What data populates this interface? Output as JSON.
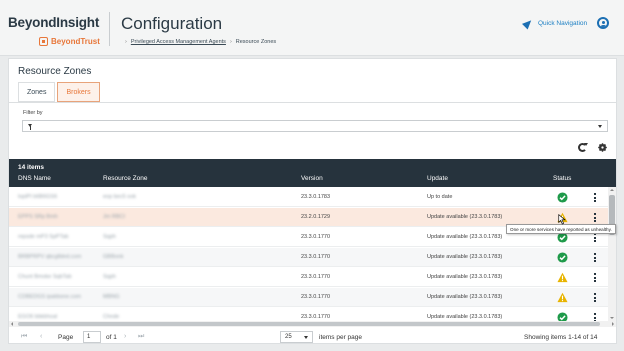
{
  "header": {
    "brand_name": "BeyondInsight",
    "brand_sub": "BeyondTrust",
    "page_title": "Configuration",
    "breadcrumb": [
      "Privileged Access Management Agents",
      "Resource Zones"
    ],
    "quick_nav_label": "Quick Navigation"
  },
  "card": {
    "title": "Resource Zones",
    "tabs": [
      {
        "label": "Zones",
        "active": false
      },
      {
        "label": "Brokers",
        "active": true
      }
    ],
    "filter_label": "Filter by"
  },
  "table": {
    "items_count": "14 items",
    "columns": [
      "DNS Name",
      "Resource Zone",
      "Version",
      "Update",
      "Status"
    ],
    "rows": [
      {
        "dns": "lopiPI b6B6GS6",
        "zone": "eop bec5 ook",
        "version": "23.3.0.1783",
        "update": "Up to date",
        "status": "ok",
        "style": "normal"
      },
      {
        "dns": "EPPS SRp Bmh",
        "zone": "Jm RBCI",
        "version": "23.2.0.1729",
        "update": "Update available (23.3.0.1783)",
        "status": "warn",
        "style": "selected"
      },
      {
        "dns": "repsde mP3 SpPTab",
        "zone": "Sqph",
        "version": "23.3.0.1770",
        "update": "Update available (23.3.0.1783)",
        "status": "ok",
        "style": "normal"
      },
      {
        "dns": "BRBPRPV qbcglbled.com",
        "zone": "GBBonk",
        "version": "23.3.0.1770",
        "update": "Update available (23.3.0.1783)",
        "status": "ok",
        "style": "alt"
      },
      {
        "dns": "Chunt Bmoke SqbTab",
        "zone": "Sqph",
        "version": "23.3.0.1770",
        "update": "Update available (23.3.0.1783)",
        "status": "warn",
        "style": "normal"
      },
      {
        "dns": "CDBEDGS ipakbone.com",
        "zone": "MBNG",
        "version": "23.3.0.1770",
        "update": "Update available (23.3.0.1783)",
        "status": "warn",
        "style": "alt"
      },
      {
        "dns": "EGO6 bbkbhoal",
        "zone": "Chnde",
        "version": "23.3.0.1770",
        "update": "Update available (23.3.0.1783)",
        "status": "ok",
        "style": "normal"
      }
    ],
    "tooltip": "One or more services have reported as unhealthy."
  },
  "pager": {
    "page_label": "Page",
    "page_value": "1",
    "of_label": "of 1",
    "per_page_value": "25",
    "per_page_label": "items per page",
    "showing": "Showing items 1-14 of 14"
  },
  "colors": {
    "accent": "#e8773a",
    "link": "#1c7fc3",
    "table_header": "#26333d",
    "ok": "#1f9a4a",
    "warn": "#e8b400"
  }
}
